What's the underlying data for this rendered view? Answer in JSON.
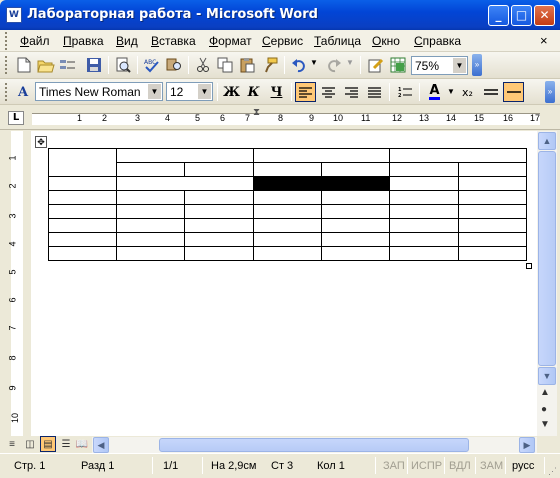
{
  "app": {
    "title": "Лабораторная работа - Microsoft Word",
    "icon_name": "word-document-icon",
    "title_icon_glyph": "W"
  },
  "menu": {
    "items": [
      "Файл",
      "Правка",
      "Вид",
      "Вставка",
      "Формат",
      "Сервис",
      "Таблица",
      "Окно",
      "Справка"
    ],
    "close_glyph": "×"
  },
  "standard_toolbar": {
    "zoom": "75%",
    "icons": [
      "new-document-icon",
      "open-folder-icon",
      "permission-icon",
      "save-icon",
      "print-preview-icon",
      "spelling-icon",
      "research-icon",
      "cut-icon",
      "copy-icon",
      "paste-icon",
      "format-painter-icon",
      "undo-icon",
      "redo-icon",
      "insert-hyperlink-icon",
      "excel-worksheet-icon"
    ]
  },
  "formatting_toolbar": {
    "style_glyph": "A",
    "font": "Times New Roman",
    "size": "12",
    "bold": "Ж",
    "italic": "К",
    "underline": "Ч",
    "font_color_glyph": "A",
    "subscript": "x₂"
  },
  "ruler": {
    "corner_glyph": "L",
    "numbers": [
      "1",
      "2",
      "3",
      "4",
      "5",
      "6",
      "7",
      "8",
      "9",
      "10",
      "11",
      "12",
      "13",
      "14",
      "15",
      "16",
      "17"
    ]
  },
  "vertical_ruler": {
    "numbers": [
      "1",
      "2",
      "3",
      "4",
      "5",
      "6",
      "7",
      "8",
      "9",
      "10"
    ]
  },
  "document": {
    "table": {
      "rows": 8,
      "cols": 7,
      "highlighted_cell": "row 3, columns 4–5 (filled black)"
    }
  },
  "statusbar": {
    "page": "Стр. 1",
    "section": "Разд 1",
    "pages": "1/1",
    "position": "На 2,9см",
    "line": "Ст 3",
    "column": "Кол 1",
    "rec": "ЗАП",
    "track": "ИСПР",
    "ext": "ВДЛ",
    "ovr": "ЗАМ",
    "language": "русс"
  },
  "colors": {
    "title_bar": "#0A5FE8",
    "active_button": "#FFC876",
    "font_color": "#0000FF"
  }
}
